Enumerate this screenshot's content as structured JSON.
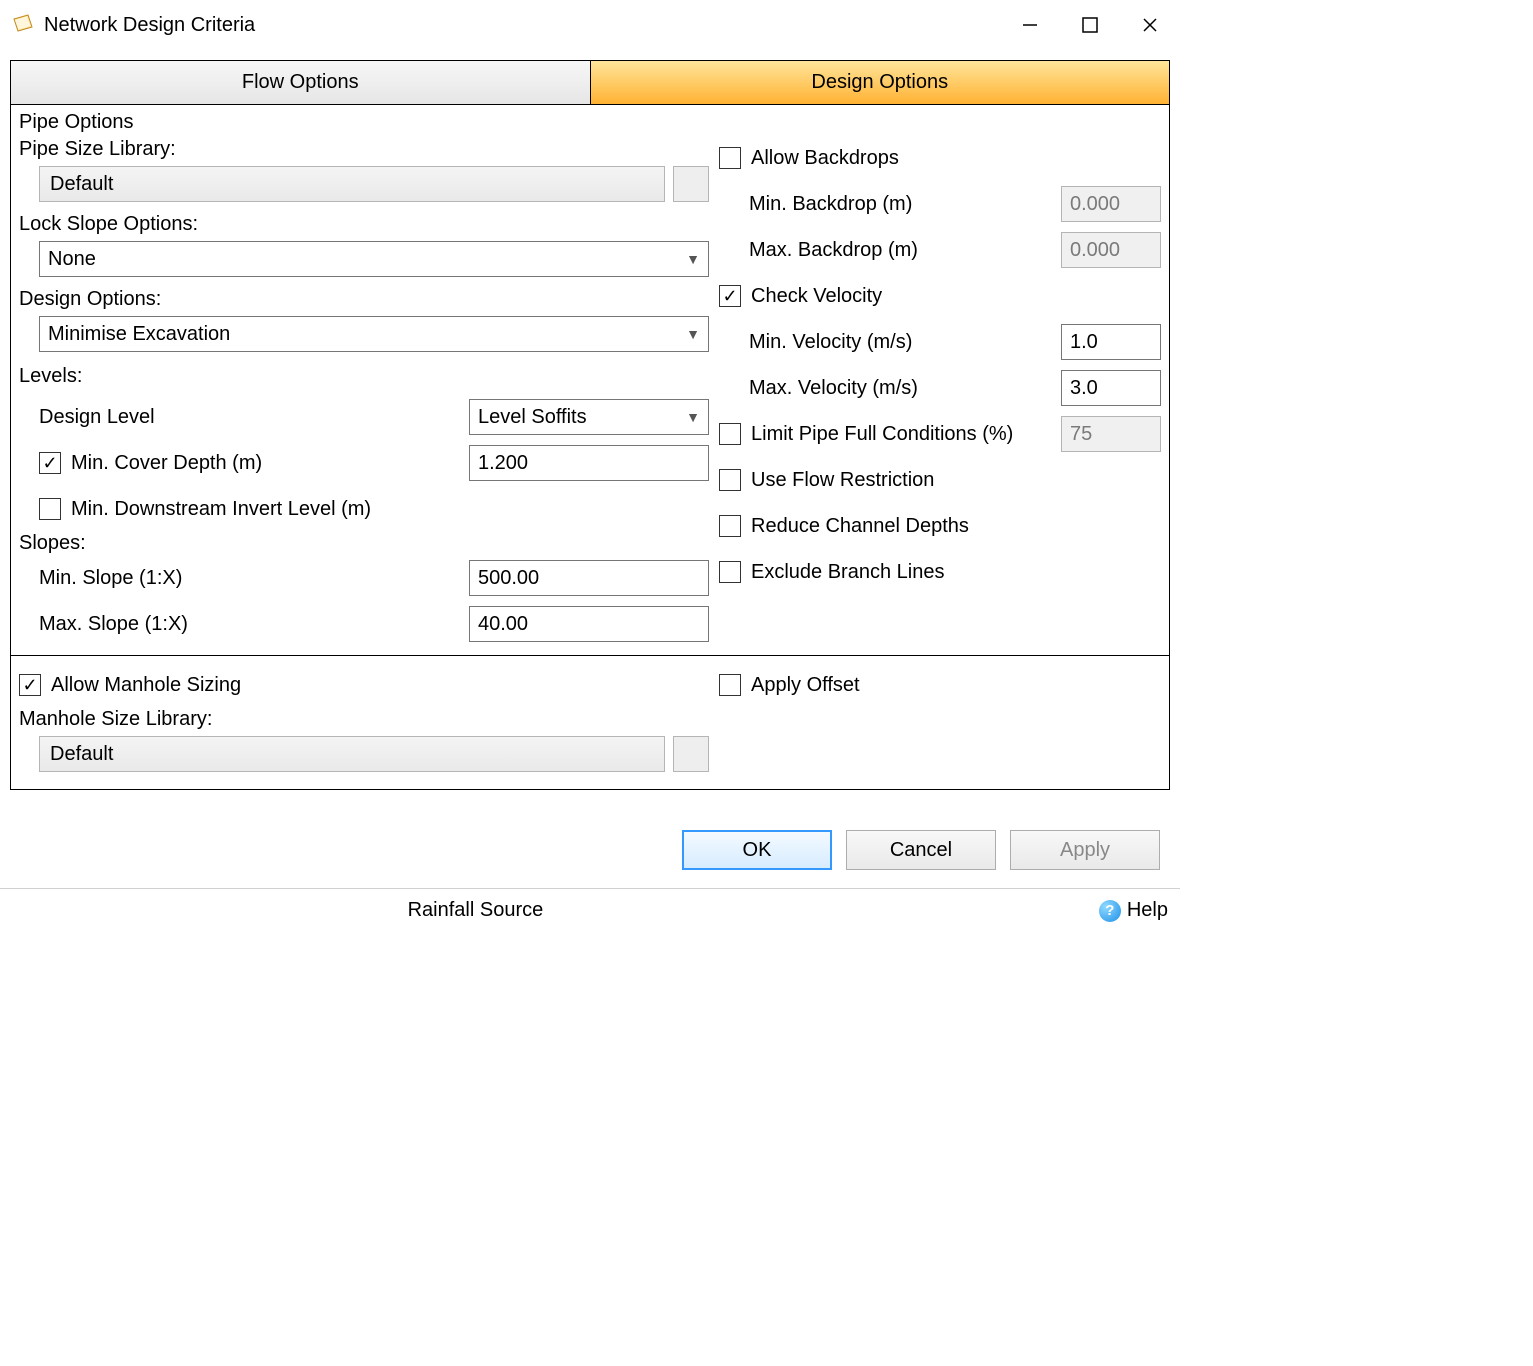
{
  "window": {
    "title": "Network Design Criteria"
  },
  "tabs": {
    "flow": "Flow Options",
    "design": "Design Options"
  },
  "pipe": {
    "section_label": "Pipe Options",
    "size_library_label": "Pipe Size Library:",
    "size_library_value": "Default",
    "lock_slope_label": "Lock Slope Options:",
    "lock_slope_value": "None",
    "design_options_label": "Design Options:",
    "design_options_value": "Minimise Excavation"
  },
  "levels": {
    "section_label": "Levels:",
    "design_level_label": "Design Level",
    "design_level_value": "Level Soffits",
    "min_cover_label": "Min. Cover Depth (m)",
    "min_cover_value": "1.200",
    "min_ds_invert_label": "Min. Downstream Invert Level (m)"
  },
  "slopes": {
    "section_label": "Slopes:",
    "min_label": "Min. Slope (1:X)",
    "min_value": "500.00",
    "max_label": "Max. Slope (1:X)",
    "max_value": "40.00"
  },
  "right": {
    "allow_backdrops": "Allow Backdrops",
    "min_backdrop_label": "Min. Backdrop (m)",
    "min_backdrop_value": "0.000",
    "max_backdrop_label": "Max. Backdrop (m)",
    "max_backdrop_value": "0.000",
    "check_velocity": "Check Velocity",
    "min_vel_label": "Min. Velocity (m/s)",
    "min_vel_value": "1.0",
    "max_vel_label": "Max. Velocity (m/s)",
    "max_vel_value": "3.0",
    "limit_full_label": "Limit Pipe Full Conditions (%)",
    "limit_full_value": "75",
    "use_flow_restriction": "Use Flow Restriction",
    "reduce_channel_depths": "Reduce Channel Depths",
    "exclude_branch_lines": "Exclude Branch Lines"
  },
  "manhole": {
    "allow_sizing": "Allow Manhole Sizing",
    "library_label": "Manhole Size Library:",
    "library_value": "Default",
    "apply_offset": "Apply Offset"
  },
  "buttons": {
    "ok": "OK",
    "cancel": "Cancel",
    "apply": "Apply"
  },
  "footer": {
    "rainfall_source": "Rainfall Source",
    "help": "Help"
  }
}
